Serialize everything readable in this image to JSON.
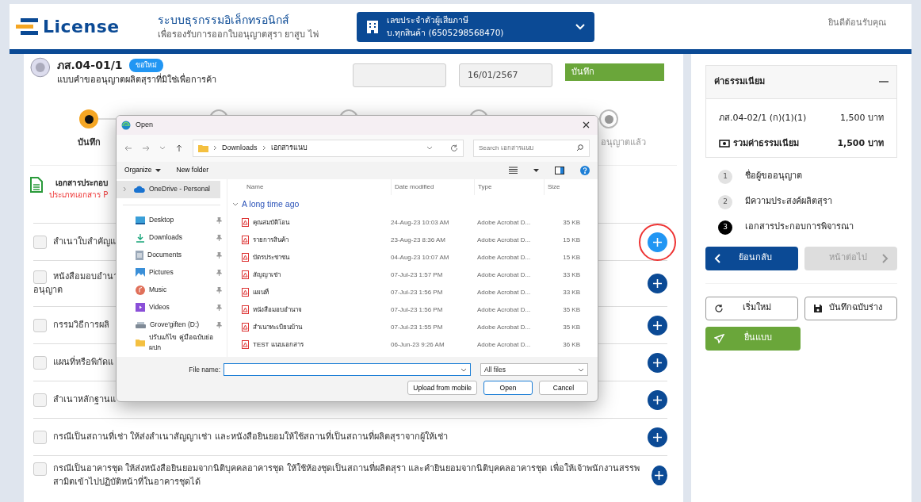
{
  "header": {
    "logo": "License",
    "system_title": "ระบบธุรกรรมอิเล็กทรอนิกส์",
    "system_subtitle": "เพื่อรองรับการออกใบอนุญาตสุรา ยาสูบ ไพ่",
    "taxpayer": {
      "label": "เลขประจำตัวผู้เสียภาษี",
      "value": "บ.ทุกสินค้า (6505298568470)"
    },
    "welcome": "ยินดีต้อนรับคุณ"
  },
  "form": {
    "code": "ภส.04-01/1",
    "badge": "ขอใหม่",
    "title": "แบบคำขออนุญาตผลิตสุราที่มิใช่เพื่อการค้า",
    "date": "16/01/2567",
    "status": "บันทึก"
  },
  "stepper": [
    {
      "label": "บันทึก",
      "selected": true
    },
    {
      "selected": false
    },
    {
      "selected": false
    },
    {
      "selected": false
    },
    {
      "label": "อนุญาตแล้ว",
      "selected": false
    }
  ],
  "documents": {
    "title": "เอกสารประกอบ",
    "note": "ประเภทเอกสาร P",
    "items": [
      {
        "text": "สำเนาใบสำคัญแ",
        "checked": false,
        "highlighted": true
      },
      {
        "text": "หนังสือมอบอำนา",
        "text_2": "อนุญาต",
        "checked": false,
        "highlighted": false
      },
      {
        "text": "กรรมวิธีการผลิ",
        "checked": false,
        "highlighted": false
      },
      {
        "text": "แผนที่หรือพิกัดแ",
        "checked": false,
        "highlighted": false
      },
      {
        "text": "สำเนาหลักฐานแ",
        "checked": false,
        "highlighted": false
      },
      {
        "text": "กรณีเป็นสถานที่เช่า ให้ส่งสำเนาสัญญาเช่า และหนังสือยินยอมให้ใช้สถานที่เป็นสถานที่ผลิตสุราจากผู้ให้เช่า",
        "checked": false,
        "highlighted": false
      },
      {
        "text": "กรณีเป็นอาคารชุด ให้ส่งหนังสือยินยอมจากนิติบุคคลอาคารชุด ให้ใช้ห้องชุดเป็นสถานที่ผลิตสุรา และคำยินยอมจากนิติบุคคลอาคารชุด เพื่อให้เจ้าพนักงานสรรพสามิตเข้าไปปฏิบัติหน้าที่ในอาคารชุดได้",
        "checked": false,
        "highlighted": false
      }
    ]
  },
  "fees": {
    "title": "ค่าธรรมเนียม",
    "expanded": true,
    "items": [
      {
        "label": "ภส.04-02/1 (ก)(1)(1)",
        "amount": "1,500 บาท"
      }
    ],
    "total": {
      "label": "รวมค่าธรรมเนียม",
      "amount": "1,500 บาท"
    }
  },
  "steps": [
    {
      "number": "1",
      "label": "ชื่อผู้ขออนุญาต",
      "selected": false
    },
    {
      "number": "2",
      "label": "มีความประสงค์ผลิตสุรา",
      "selected": false
    },
    {
      "number": "3",
      "label": "เอกสารประกอบการพิจารณา",
      "selected": true
    }
  ],
  "nav_buttons": {
    "back": "ย้อนกลับ",
    "next": {
      "label": "หน้าต่อไป",
      "disabled": true
    }
  },
  "actions": [
    "เริ่มใหม่",
    "บันทึกฉบับร่าง"
  ],
  "submit": "ยื่นแบบ",
  "dialog": {
    "title": "Open",
    "path": [
      "Downloads",
      "เอกสารแนบ"
    ],
    "search": {
      "placeholder": "Search เอกสารแนบ"
    },
    "toolbar": [
      "Organize",
      "New folder"
    ],
    "nav_items": [
      {
        "label": "OneDrive - Personal",
        "selected": true,
        "pinned": false
      },
      {
        "label": "Desktop",
        "selected": false,
        "pinned": true
      },
      {
        "label": "Downloads",
        "selected": false,
        "pinned": true
      },
      {
        "label": "Documents",
        "selected": false,
        "pinned": true
      },
      {
        "label": "Pictures",
        "selected": false,
        "pinned": true
      },
      {
        "label": "Music",
        "selected": false,
        "pinned": true
      },
      {
        "label": "Videos",
        "selected": false,
        "pinned": true
      },
      {
        "label": "Grove'giften (D:)",
        "selected": false,
        "pinned": true
      },
      {
        "label": "ปรับแก้ไข คู่มือฉบับย่อ ผปก",
        "selected": false,
        "pinned": false
      }
    ],
    "columns": [
      "Name",
      "Date modified",
      "Type",
      "Size"
    ],
    "group": "A long time ago",
    "files": [
      {
        "name": "คุณสมบัติโอน",
        "date": "24-Aug-23 10:03 AM",
        "type": "Adobe Acrobat D...",
        "size": "35 KB"
      },
      {
        "name": "รายการสินค้า",
        "date": "23-Aug-23 8:36 AM",
        "type": "Adobe Acrobat D...",
        "size": "15 KB"
      },
      {
        "name": "บัตรประชาชน",
        "date": "04-Aug-23 10:07 AM",
        "type": "Adobe Acrobat D...",
        "size": "15 KB"
      },
      {
        "name": "สัญญาเช่า",
        "date": "07-Jul-23 1:57 PM",
        "type": "Adobe Acrobat D...",
        "size": "33 KB"
      },
      {
        "name": "แผนที่",
        "date": "07-Jul-23 1:56 PM",
        "type": "Adobe Acrobat D...",
        "size": "33 KB"
      },
      {
        "name": "หนังสือมอบอำนาจ",
        "date": "07-Jul-23 1:56 PM",
        "type": "Adobe Acrobat D...",
        "size": "35 KB"
      },
      {
        "name": "สำเนาทะเบียนบ้าน",
        "date": "07-Jul-23 1:55 PM",
        "type": "Adobe Acrobat D...",
        "size": "35 KB"
      },
      {
        "name": "TEST แนบเอกสาร",
        "date": "06-Jun-23 9:26 AM",
        "type": "Adobe Acrobat D...",
        "size": "36 KB"
      }
    ],
    "file_name_label": "File name:",
    "filter": "All files",
    "buttons": [
      "Upload from mobile",
      "Open",
      "Cancel"
    ]
  }
}
